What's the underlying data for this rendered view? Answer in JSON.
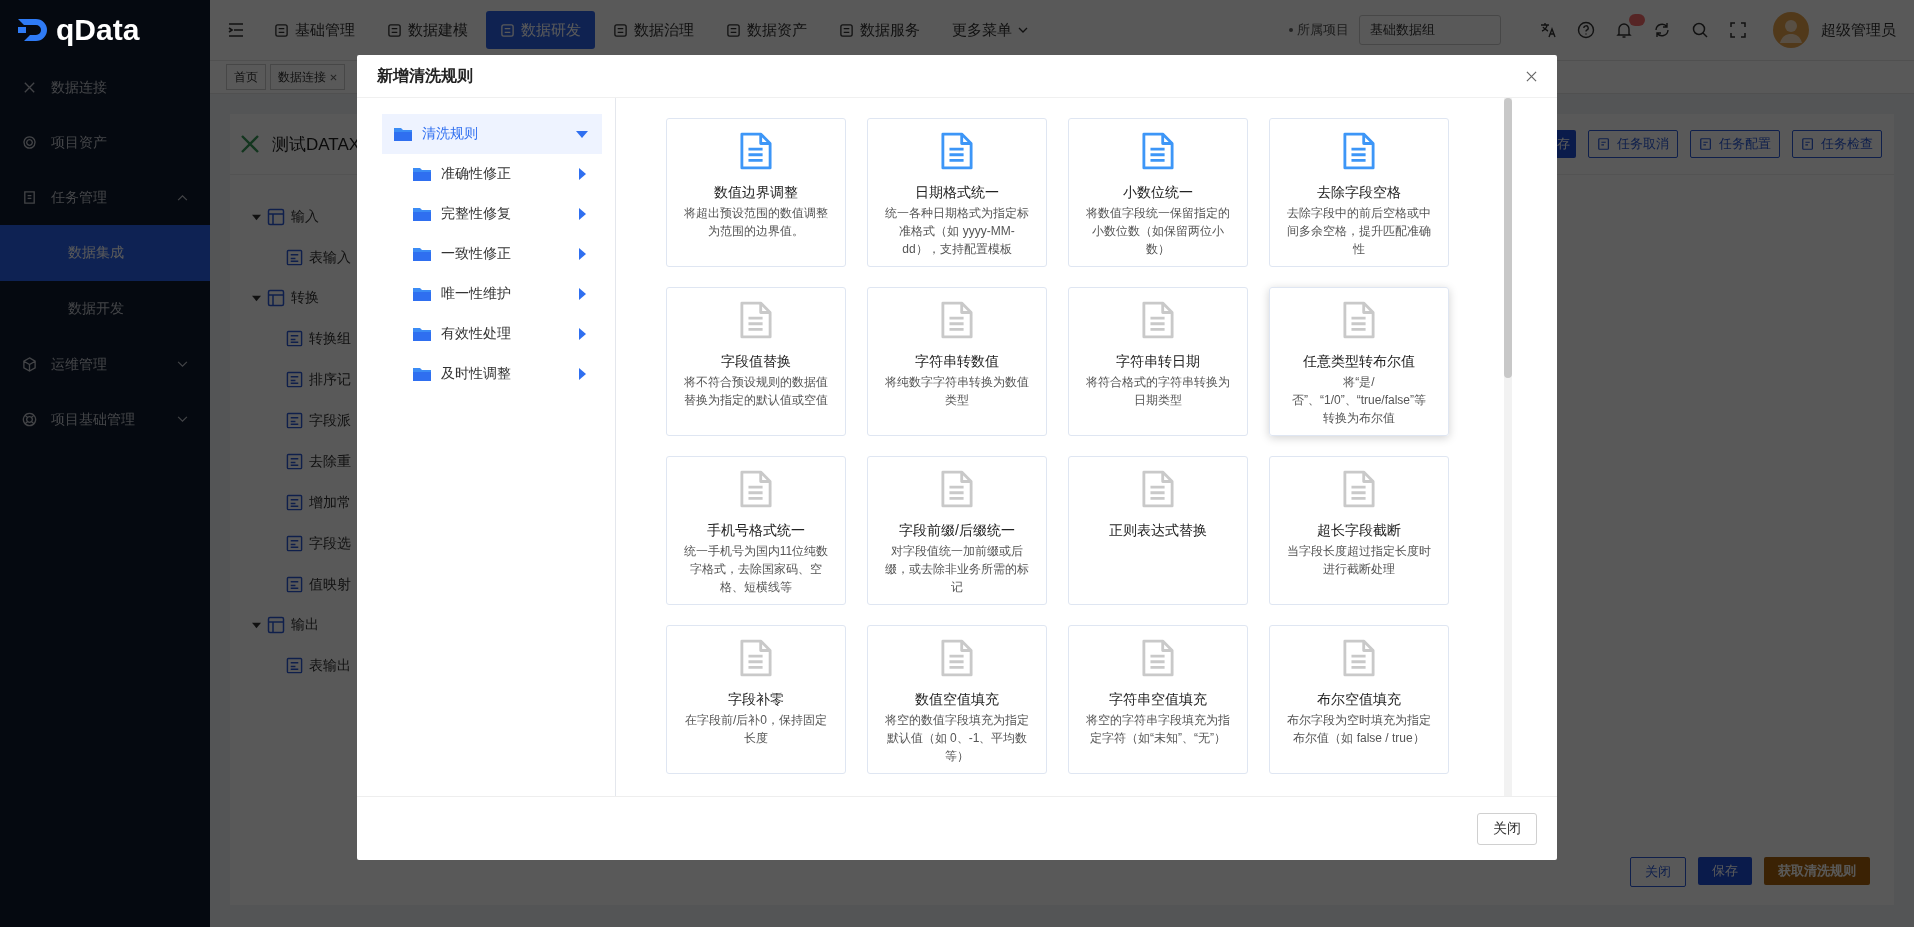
{
  "sidebar": {
    "logo": "qData",
    "items": [
      {
        "label": "数据连接",
        "kind": "link"
      },
      {
        "label": "项目资产",
        "kind": "link"
      },
      {
        "label": "任务管理",
        "kind": "group",
        "expanded": true,
        "children": [
          {
            "label": "数据集成",
            "selected": true
          },
          {
            "label": "数据开发",
            "selected": false
          }
        ]
      },
      {
        "label": "运维管理",
        "kind": "group",
        "expanded": false
      },
      {
        "label": "项目基础管理",
        "kind": "group",
        "expanded": false
      }
    ]
  },
  "topbar": {
    "nav": [
      {
        "label": "基础管理",
        "selected": false
      },
      {
        "label": "数据建模",
        "selected": false
      },
      {
        "label": "数据研发",
        "selected": true
      },
      {
        "label": "数据治理",
        "selected": false
      },
      {
        "label": "数据资产",
        "selected": false
      },
      {
        "label": "数据服务",
        "selected": false
      }
    ],
    "more_menu": "更多菜单",
    "project_label": "所属项目",
    "project_value": "基础数据组",
    "user": "超级管理员"
  },
  "tabs": [
    {
      "label": "首页",
      "closable": false
    },
    {
      "label": "数据连接",
      "closable": true
    }
  ],
  "task": {
    "title": "测试DATAX",
    "actions": [
      {
        "label": "存",
        "kind": "primary"
      },
      {
        "label": "任务取消",
        "kind": "plain"
      },
      {
        "label": "任务配置",
        "kind": "plain"
      },
      {
        "label": "任务检查",
        "kind": "plain"
      }
    ],
    "tree": [
      {
        "label": "输入",
        "expanded": true,
        "children": [
          {
            "label": "表输入"
          }
        ]
      },
      {
        "label": "转换",
        "expanded": true,
        "children": [
          {
            "label": "转换组"
          },
          {
            "label": "排序记"
          },
          {
            "label": "字段派"
          },
          {
            "label": "去除重"
          },
          {
            "label": "增加常"
          },
          {
            "label": "字段选"
          },
          {
            "label": "值映射"
          }
        ]
      },
      {
        "label": "输出",
        "expanded": true,
        "children": [
          {
            "label": "表输出"
          }
        ]
      }
    ],
    "footer_buttons": [
      {
        "label": "关闭",
        "kind": "plain"
      },
      {
        "label": "保存",
        "kind": "primary"
      },
      {
        "label": "获取清洗规则",
        "kind": "warning"
      }
    ]
  },
  "dialog": {
    "title": "新增清洗规则",
    "tree": {
      "label": "清洗规则",
      "selected": true,
      "expanded": true,
      "children": [
        {
          "label": "准确性修正",
          "selected": false,
          "expanded": false
        },
        {
          "label": "完整性修复",
          "selected": false,
          "expanded": false
        },
        {
          "label": "一致性修正",
          "selected": false,
          "expanded": false
        },
        {
          "label": "唯一性维护",
          "selected": false,
          "expanded": false
        },
        {
          "label": "有效性处理",
          "selected": false,
          "expanded": false
        },
        {
          "label": "及时性调整",
          "selected": false,
          "expanded": false
        }
      ]
    },
    "cards": [
      {
        "title": "数值边界调整",
        "description": "将超出预设范围的数值调整为范围的边界值。",
        "highlighted": true,
        "hovered": false
      },
      {
        "title": "日期格式统一",
        "description": "统一各种日期格式为指定标准格式（如 yyyy-MM-dd），支持配置模板",
        "highlighted": true,
        "hovered": false
      },
      {
        "title": "小数位统一",
        "description": "将数值字段统一保留指定的小数位数（如保留两位小数）",
        "highlighted": true,
        "hovered": false
      },
      {
        "title": "去除字段空格",
        "description": "去除字段中的前后空格或中间多余空格，提升匹配准确性",
        "highlighted": true,
        "hovered": false
      },
      {
        "title": "字段值替换",
        "description": "将不符合预设规则的数据值替换为指定的默认值或空值",
        "highlighted": false,
        "hovered": false
      },
      {
        "title": "字符串转数值",
        "description": "将纯数字字符串转换为数值类型",
        "highlighted": false,
        "hovered": false
      },
      {
        "title": "字符串转日期",
        "description": "将符合格式的字符串转换为日期类型",
        "highlighted": false,
        "hovered": false
      },
      {
        "title": "任意类型转布尔值",
        "description": "将“是/否”、“1/0”、“true/false”等转换为布尔值",
        "highlighted": false,
        "hovered": true
      },
      {
        "title": "手机号格式统一",
        "description": "统一手机号为国内11位纯数字格式，去除国家码、空格、短横线等",
        "highlighted": false,
        "hovered": false
      },
      {
        "title": "字段前缀/后缀统一",
        "description": "对字段值统一加前缀或后缀，或去除非业务所需的标记",
        "highlighted": false,
        "hovered": false
      },
      {
        "title": "正则表达式替换",
        "highlighted": false,
        "hovered": false
      },
      {
        "title": "超长字段截断",
        "description": "当字段长度超过指定长度时进行截断处理",
        "highlighted": false,
        "hovered": false
      },
      {
        "title": "字段补零",
        "description": "在字段前/后补0，保持固定长度",
        "highlighted": false,
        "hovered": false
      },
      {
        "title": "数值空值填充",
        "description": "将空的数值字段填充为指定默认值（如 0、-1、平均数等）",
        "highlighted": false,
        "hovered": false
      },
      {
        "title": "字符串空值填充",
        "description": "将空的字符串字段填充为指定字符（如“未知”、“无”）",
        "highlighted": false,
        "hovered": false
      },
      {
        "title": "布尔空值填充",
        "description": "布尔字段为空时填充为指定布尔值（如 false / true）",
        "highlighted": false,
        "hovered": false
      }
    ],
    "footer_buttons": [
      "关闭"
    ]
  }
}
